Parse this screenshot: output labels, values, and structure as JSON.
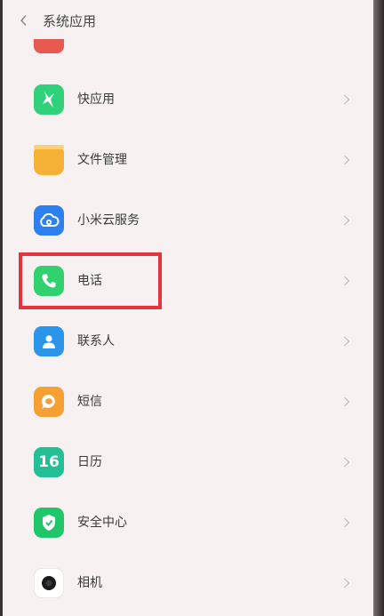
{
  "header": {
    "title": "系统应用"
  },
  "list": {
    "partial_top_label": "",
    "items": [
      {
        "label": "快应用",
        "icon": "quick-app-icon",
        "color": "#2fd27a"
      },
      {
        "label": "文件管理",
        "icon": "file-manager-icon",
        "color": "#f5b236"
      },
      {
        "label": "小米云服务",
        "icon": "cloud-service-icon",
        "color": "#2e7ff0"
      },
      {
        "label": "电话",
        "icon": "phone-icon",
        "color": "#2fd26f"
      },
      {
        "label": "联系人",
        "icon": "contacts-icon",
        "color": "#2b95ea"
      },
      {
        "label": "短信",
        "icon": "messages-icon",
        "color": "#f6a033"
      },
      {
        "label": "日历",
        "icon": "calendar-icon",
        "color": "#23c096",
        "icon_text": "16"
      },
      {
        "label": "安全中心",
        "icon": "security-center-icon",
        "color": "#1fc76a"
      },
      {
        "label": "相机",
        "icon": "camera-icon",
        "color": "#ffffff"
      }
    ]
  },
  "annotation": {
    "highlight_color": "#e5343b"
  }
}
